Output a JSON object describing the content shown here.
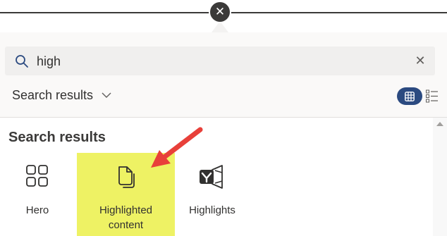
{
  "close_button": {
    "icon": "close-icon",
    "glyph": "✕"
  },
  "search": {
    "value": "high",
    "placeholder": "Search",
    "icon": "search-icon",
    "clear_glyph": "✕"
  },
  "filter": {
    "label": "Search results",
    "icon": "chevron-down-icon"
  },
  "view_toggle": {
    "grid_icon": "grid-view-icon",
    "list_icon": "list-view-icon",
    "accent": "#2b4a80"
  },
  "results": {
    "heading": "Search results",
    "items": [
      {
        "label": "Hero",
        "icon": "hero-icon"
      },
      {
        "label": "Highlighted content",
        "label_lines": [
          "Highlighted",
          "content"
        ],
        "icon": "highlighted-content-icon",
        "highlight_color": "#eef264"
      },
      {
        "label": "Highlights",
        "icon": "yammer-highlights-icon"
      }
    ]
  },
  "annotation": {
    "icon": "red-arrow-icon",
    "color": "#e8403a"
  }
}
